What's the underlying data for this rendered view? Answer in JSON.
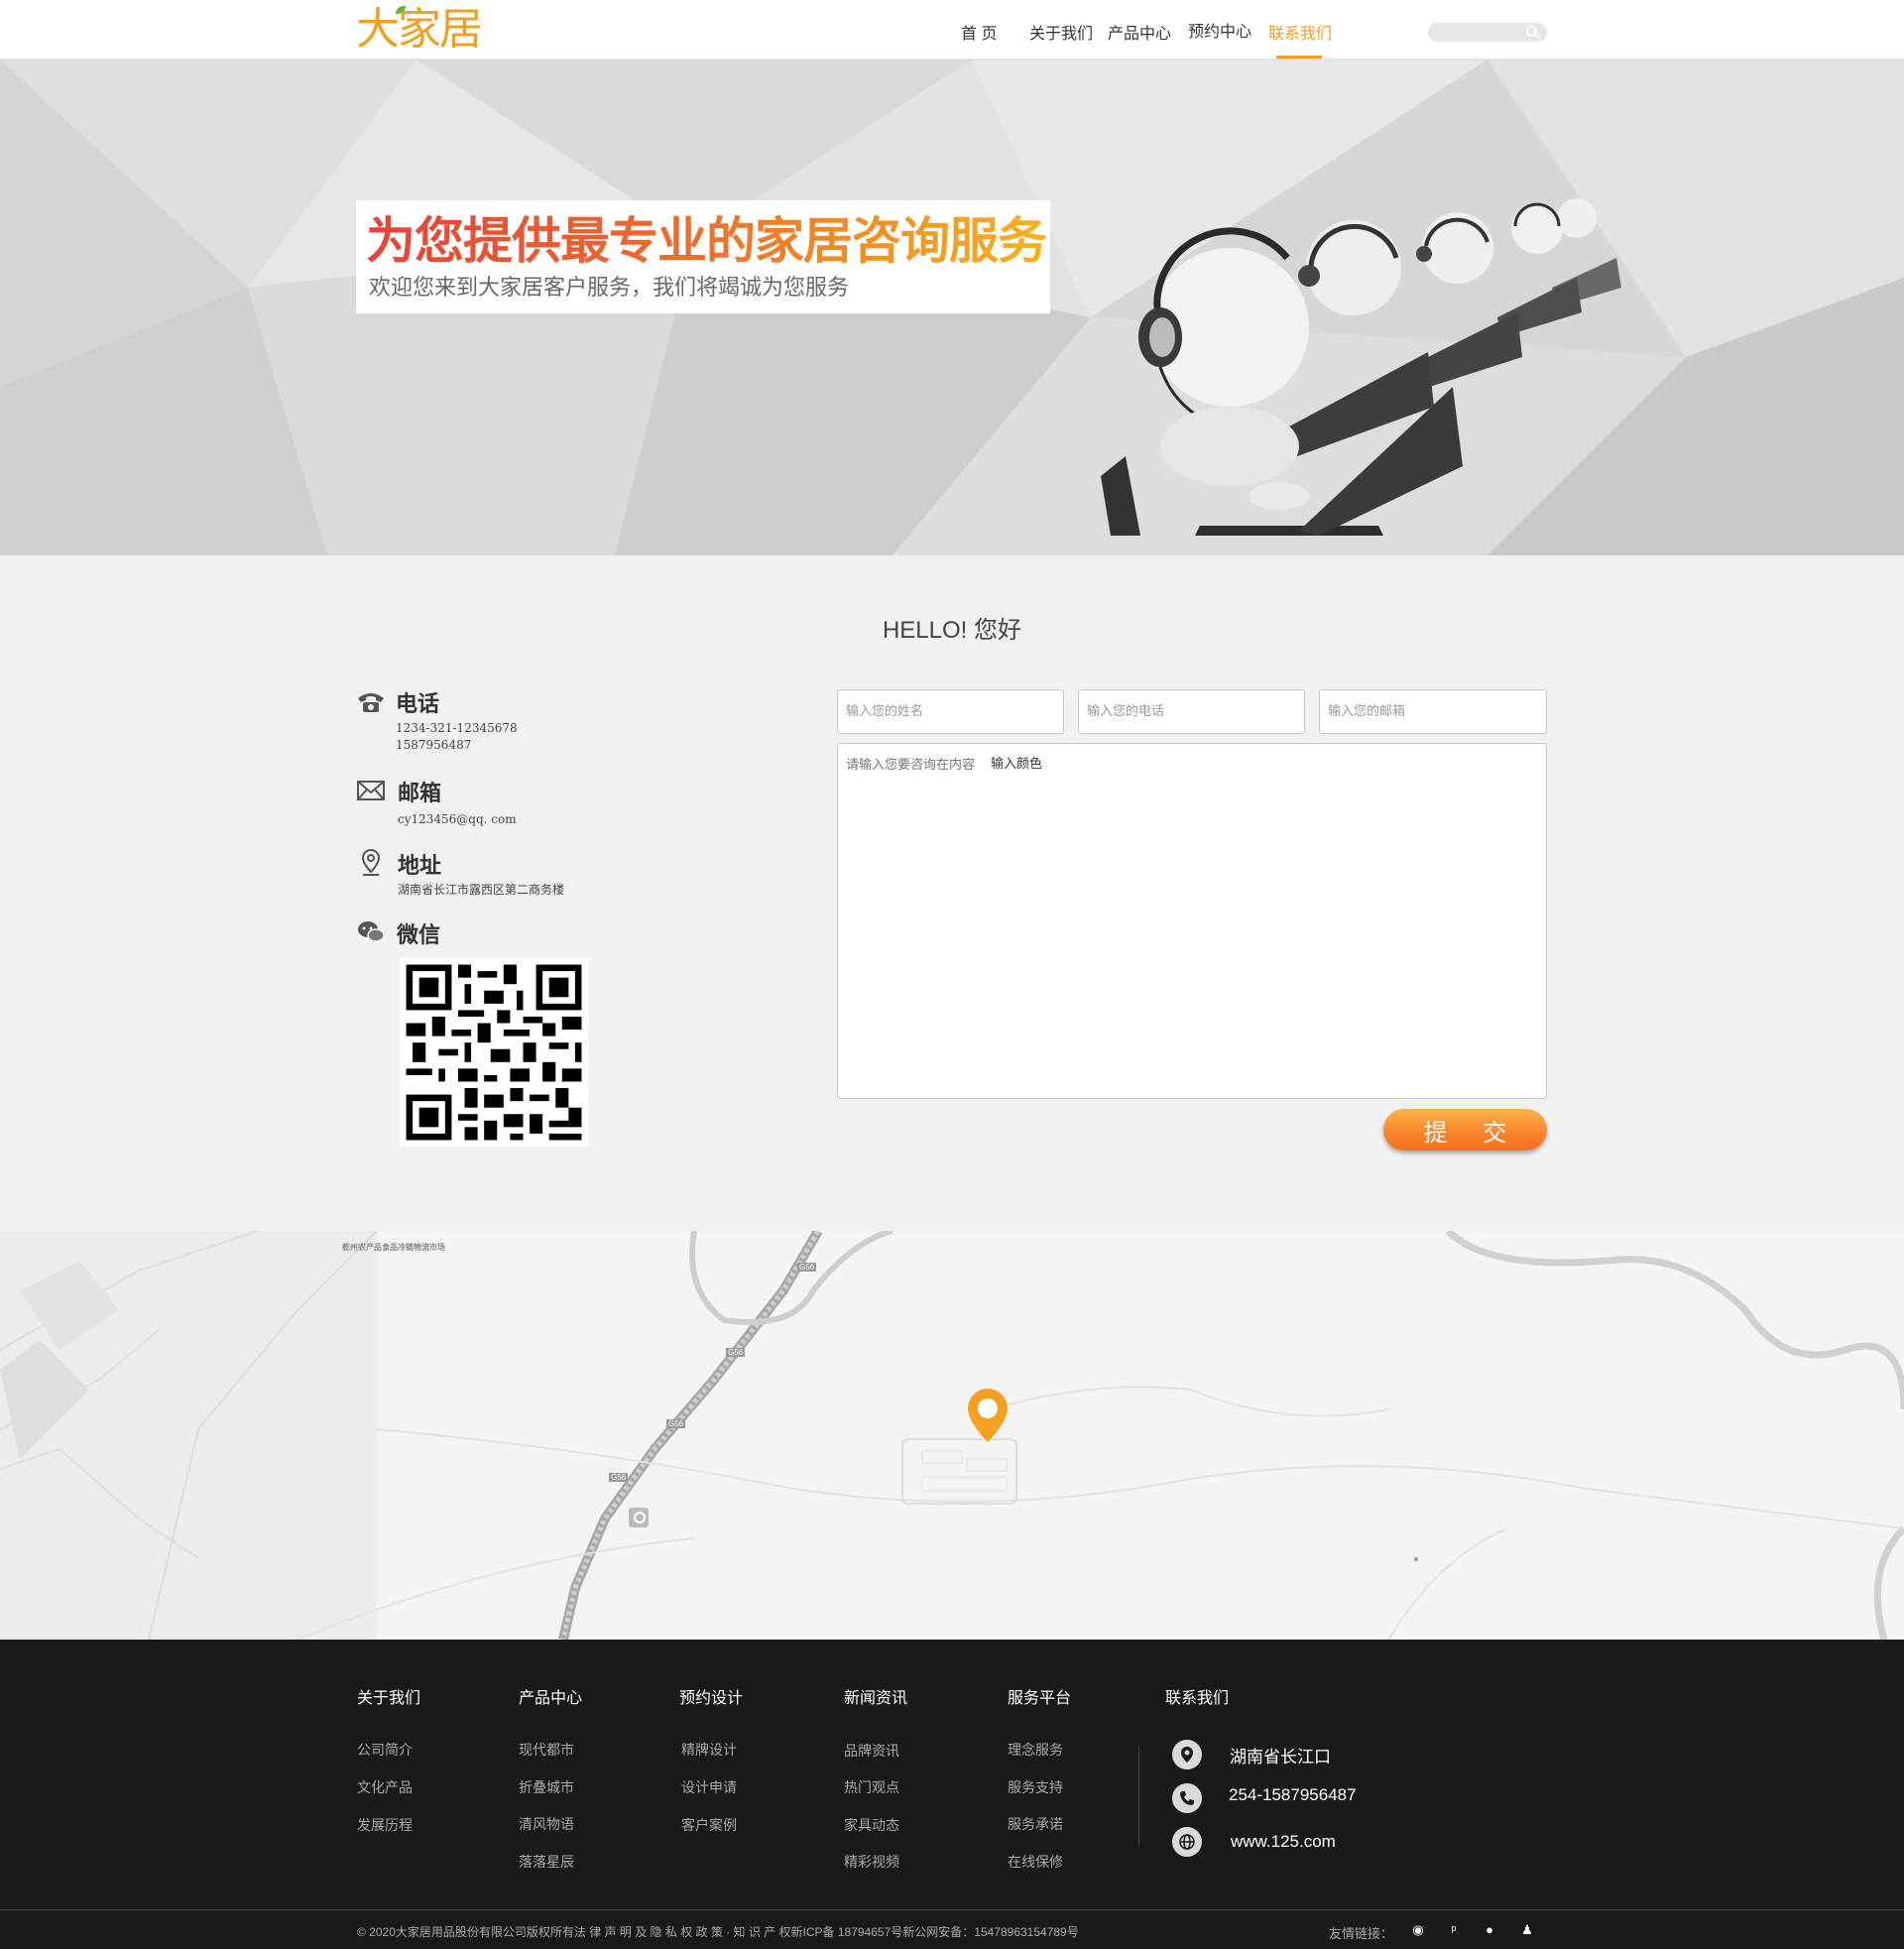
{
  "header": {
    "logo": "大家居",
    "nav": [
      {
        "label": "首 页"
      },
      {
        "label": "关于我们"
      },
      {
        "label": "产品中心"
      },
      {
        "label": "预约中心"
      },
      {
        "label": "联系我们"
      }
    ],
    "active_nav": "联系我们",
    "search_placeholder": ""
  },
  "banner": {
    "title": "为您提供最专业的家居咨询服务",
    "subtitle": "欢迎您来到大家居客户服务，我们将竭诚为您服务"
  },
  "contact": {
    "heading": "HELLO! 您好",
    "phone": {
      "title": "电话",
      "values": [
        "1234-321-12345678",
        "1587956487"
      ]
    },
    "email": {
      "title": "邮箱",
      "value": "cy123456@qq. com"
    },
    "address": {
      "title": "地址",
      "value": "湖南省长江市露西区第二商务楼"
    },
    "wechat": {
      "title": "微信"
    }
  },
  "form": {
    "name_placeholder": "输入您的姓名",
    "phone_placeholder": "输入您的电话",
    "email_placeholder": "输入您的邮箱",
    "content_placeholder": "请输入您要咨询在内容",
    "content_extra": "输入颜色",
    "submit_label": "提 交"
  },
  "map": {
    "labels": [
      "乾州农产品食品冷链物流市场",
      "G56",
      "G56",
      "G56",
      "G56"
    ]
  },
  "footer": {
    "columns": [
      {
        "title": "关于我们",
        "items": [
          "公司简介",
          "文化产品",
          "发展历程"
        ]
      },
      {
        "title": "产品中心",
        "items": [
          "现代都市",
          "折叠城市",
          "清风物语",
          "落落星辰"
        ]
      },
      {
        "title": "预约设计",
        "items": [
          "精牌设计",
          "设计申请",
          "客户案例"
        ]
      },
      {
        "title": "新闻资讯",
        "items": [
          "品牌资讯",
          "热门观点",
          "家具动态",
          "精彩视频"
        ]
      },
      {
        "title": "服务平台",
        "items": [
          "理念服务",
          "服务支持",
          "服务承诺",
          "在线保修"
        ]
      }
    ],
    "contact_title": "联系我们",
    "contact": {
      "address": "湖南省长江口",
      "phone": "254-1587956487",
      "website": "www.125.com"
    },
    "copyright": "© 2020大家居用品股份有限公司版权所有法 律 声 明 及 隐 私 权 政 策 · 知 识 产 权新ICP备 18794657号新公网安备：15478963154789号",
    "friend_links": "友情链接：",
    "social_icons": [
      "weibo-icon",
      "tencent-weibo-icon",
      "wechat-icon",
      "qq-icon"
    ]
  },
  "colors": {
    "accent": "#f39a26",
    "footer_bg": "#1a1a1a",
    "page_bg": "#f1f1f1"
  }
}
